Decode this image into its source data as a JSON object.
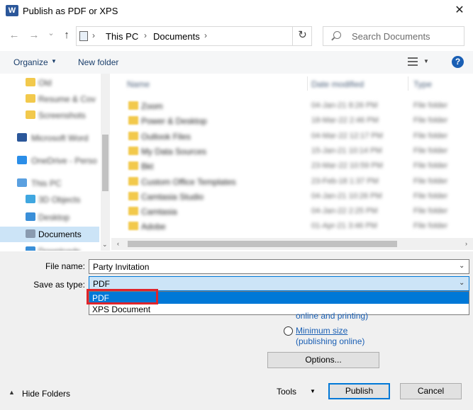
{
  "window": {
    "title": "Publish as PDF or XPS",
    "app_icon": "W"
  },
  "nav": {
    "back_icon": "←",
    "forward_icon": "→",
    "recent_icon": "⌄",
    "up_icon": "↑",
    "breadcrumb": [
      "This PC",
      "Documents"
    ],
    "refresh_icon": "↻",
    "search_placeholder": "Search Documents"
  },
  "toolbar": {
    "organize": "Organize",
    "new_folder": "New folder",
    "help": "?"
  },
  "left_pane": {
    "items": [
      {
        "label": "Old",
        "icon": "folder-icon",
        "color": "#f2c94c",
        "indent": 1
      },
      {
        "label": "Resume & Cov",
        "icon": "folder-icon",
        "color": "#f2c94c",
        "indent": 1
      },
      {
        "label": "Screenshots",
        "icon": "folder-icon",
        "color": "#f2c94c",
        "indent": 1
      },
      {
        "label": "Microsoft Word",
        "icon": "word-icon",
        "color": "#2b579a",
        "indent": 0
      },
      {
        "label": "OneDrive - Perso",
        "icon": "onedrive-icon",
        "color": "#2b8ee8",
        "indent": 0
      },
      {
        "label": "This PC",
        "icon": "pc-icon",
        "color": "#5aa0e0",
        "indent": 0
      },
      {
        "label": "3D Objects",
        "icon": "cube-icon",
        "color": "#40a7e0",
        "indent": 1
      },
      {
        "label": "Desktop",
        "icon": "desktop-icon",
        "color": "#3a8fd8",
        "indent": 1
      },
      {
        "label": "Documents",
        "icon": "documents-icon",
        "color": "#8a9bb0",
        "indent": 1,
        "selected": true
      },
      {
        "label": "Downloads",
        "icon": "downloads-icon",
        "color": "#3a8fd8",
        "indent": 1
      }
    ]
  },
  "file_list": {
    "columns": [
      "Name",
      "Date modified",
      "Type"
    ],
    "rows": [
      {
        "name": "Zoom",
        "date": "04-Jan-21 8:26 PM",
        "type": "File folder"
      },
      {
        "name": "Power & Desktop",
        "date": "18-Mar-22 2:46 PM",
        "type": "File folder"
      },
      {
        "name": "Outlook Files",
        "date": "04-Mar-22 12:17 PM",
        "type": "File folder"
      },
      {
        "name": "My Data Sources",
        "date": "15-Jan-21 10:14 PM",
        "type": "File folder"
      },
      {
        "name": "Bkt",
        "date": "23-Mar-22 10:59 PM",
        "type": "File folder"
      },
      {
        "name": "Custom Office Templates",
        "date": "23-Feb-18 1:37 PM",
        "type": "File folder"
      },
      {
        "name": "Camtasia Studio",
        "date": "04-Jan-21 10:26 PM",
        "type": "File folder"
      },
      {
        "name": "Camtasia",
        "date": "04-Jan-22 2:25 PM",
        "type": "File folder"
      },
      {
        "name": "Adobe",
        "date": "01-Apr-21 3:46 PM",
        "type": "File folder"
      }
    ]
  },
  "form": {
    "file_name_label": "File name:",
    "file_name_value": "Party Invitation",
    "save_type_label": "Save as type:",
    "save_type_value": "PDF",
    "type_options": [
      "PDF",
      "XPS Document"
    ],
    "standard_sub": "online and printing)",
    "minimum_label": "Minimum size",
    "minimum_sub": "(publishing online)",
    "options_button": "Options..."
  },
  "footer": {
    "hide_folders": "Hide Folders",
    "tools": "Tools",
    "publish": "Publish",
    "cancel": "Cancel"
  },
  "colors": {
    "accent": "#0078d7",
    "highlight": "#e0242b",
    "link": "#1a5fb4"
  }
}
